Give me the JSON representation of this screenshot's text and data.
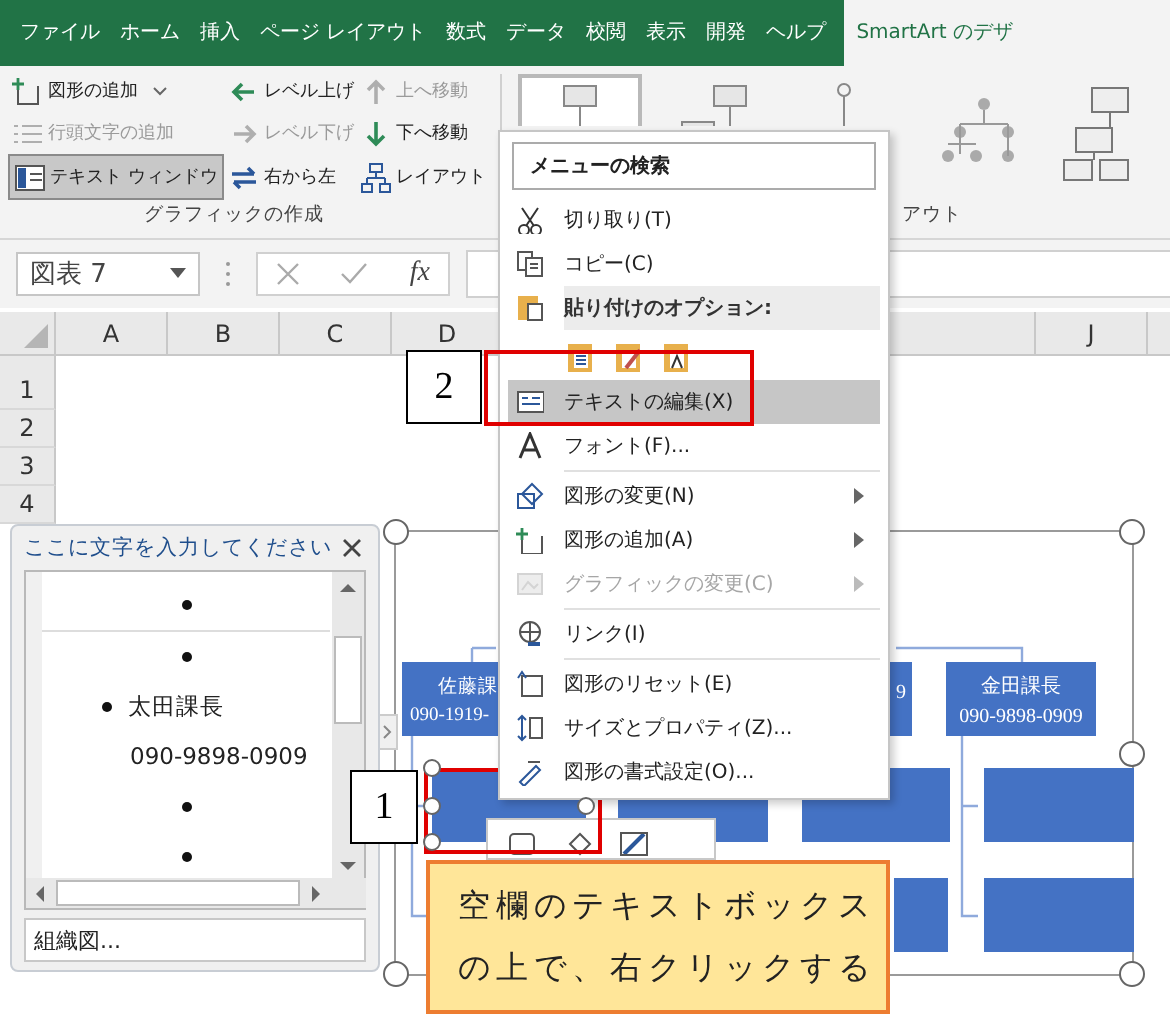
{
  "ribbon_tabs": [
    {
      "label": "ファイル",
      "selected": false
    },
    {
      "label": "ホーム",
      "selected": false
    },
    {
      "label": "挿入",
      "selected": false
    },
    {
      "label": "ページ レイアウト",
      "selected": false
    },
    {
      "label": "数式",
      "selected": false
    },
    {
      "label": "データ",
      "selected": false
    },
    {
      "label": "校閲",
      "selected": false
    },
    {
      "label": "表示",
      "selected": false
    },
    {
      "label": "開発",
      "selected": false
    },
    {
      "label": "ヘルプ",
      "selected": false
    },
    {
      "label": "SmartArt のデザ",
      "selected": true
    }
  ],
  "create_graphic_group": {
    "label": "グラフィックの作成",
    "commands": [
      {
        "label": "図形の追加",
        "dropdown": true,
        "disabled": false,
        "pressed": false
      },
      {
        "label": "レベル上げ",
        "disabled": false,
        "pressed": false
      },
      {
        "label": "上へ移動",
        "disabled": true,
        "pressed": false
      },
      {
        "label": "行頭文字の追加",
        "disabled": true,
        "pressed": false
      },
      {
        "label": "レベル下げ",
        "disabled": true,
        "pressed": false
      },
      {
        "label": "下へ移動",
        "disabled": false,
        "pressed": false
      },
      {
        "label": "テキスト ウィンドウ",
        "disabled": false,
        "pressed": true
      },
      {
        "label": "右から左",
        "disabled": false,
        "pressed": false
      },
      {
        "label": "レイアウト",
        "disabled": false,
        "pressed": false
      }
    ]
  },
  "layouts_group": {
    "label": "アウト",
    "layouts": [
      {
        "selected": true
      },
      {
        "selected": false
      },
      {
        "selected": false
      },
      {
        "selected": false
      },
      {
        "selected": false
      }
    ]
  },
  "formula_bar": {
    "name_box": "図表 7",
    "function_button": "fx"
  },
  "sheet": {
    "columns": [
      "A",
      "B",
      "C",
      "D"
    ],
    "far_columns": [
      "J"
    ],
    "rows": [
      "1",
      "2",
      "3",
      "4"
    ]
  },
  "text_pane": {
    "title": "ここに文字を入力してください",
    "lines": [
      {
        "kind": "bullet"
      },
      {
        "kind": "bullet"
      },
      {
        "kind": "bullet",
        "text": "太田課長"
      },
      {
        "kind": "continuation",
        "text": "090-9898-0909"
      },
      {
        "kind": "bullet"
      },
      {
        "kind": "bullet"
      }
    ],
    "footer": "組織図..."
  },
  "smartart": {
    "top_shapes": [
      {
        "lines": [
          "佐藤課",
          "090-1919-"
        ]
      },
      {
        "lines": [
          "9"
        ]
      },
      {
        "lines": [
          "金田課長",
          "090-9898-0909"
        ]
      }
    ],
    "shapes": [
      {
        "selected": true
      },
      {
        "selected": false
      },
      {
        "selected": false
      },
      {
        "selected": false
      },
      {
        "selected": false
      },
      {
        "selected": false
      }
    ]
  },
  "context_menu": {
    "search_placeholder": "メニューの検索",
    "items": [
      {
        "kind": "item",
        "label": "切り取り(T)",
        "selected": false,
        "disabled": false
      },
      {
        "kind": "item",
        "label": "コピー(C)",
        "selected": false,
        "disabled": false
      },
      {
        "kind": "header",
        "label": "貼り付けのオプション:"
      },
      {
        "kind": "paste_options"
      },
      {
        "kind": "item",
        "label": "テキストの編集(X)",
        "selected": true,
        "disabled": false
      },
      {
        "kind": "item",
        "label": "フォント(F)...",
        "selected": false,
        "disabled": false
      },
      {
        "kind": "separator"
      },
      {
        "kind": "item",
        "label": "図形の変更(N)",
        "selected": false,
        "disabled": false,
        "submenu": true
      },
      {
        "kind": "item",
        "label": "図形の追加(A)",
        "selected": false,
        "disabled": false,
        "submenu": true
      },
      {
        "kind": "item",
        "label": "グラフィックの変更(C)",
        "selected": false,
        "disabled": true,
        "submenu": true
      },
      {
        "kind": "separator"
      },
      {
        "kind": "item",
        "label": "リンク(I)",
        "selected": false,
        "disabled": false
      },
      {
        "kind": "separator"
      },
      {
        "kind": "item",
        "label": "図形のリセット(E)",
        "selected": false,
        "disabled": false
      },
      {
        "kind": "item",
        "label": "サイズとプロパティ(Z)...",
        "selected": false,
        "disabled": false
      },
      {
        "kind": "item",
        "label": "図形の書式設定(O)...",
        "selected": false,
        "disabled": false
      }
    ]
  },
  "annotations": [
    {
      "kind": "step",
      "text": "1"
    },
    {
      "kind": "step",
      "text": "2"
    },
    {
      "kind": "note",
      "lines": [
        "空欄のテキストボックス",
        "の上で、右クリックする"
      ]
    }
  ]
}
